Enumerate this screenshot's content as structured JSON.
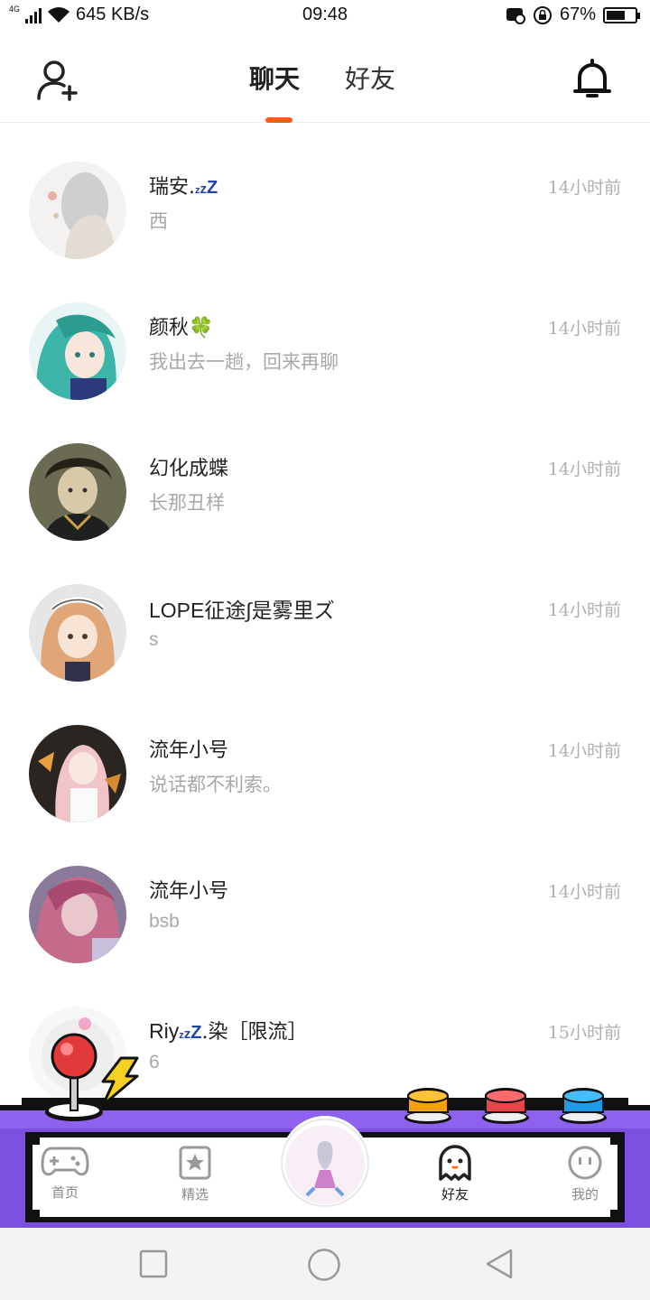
{
  "status_bar": {
    "network_type": "4G",
    "speed": "645 KB/s",
    "time": "09:48",
    "battery_percent": "67%",
    "battery_level": 0.67
  },
  "header": {
    "tabs": [
      {
        "label": "聊天",
        "active": true
      },
      {
        "label": "好友",
        "active": false
      }
    ]
  },
  "chats": [
    {
      "name": "瑞安.",
      "name_suffix": "zzZ",
      "preview": "西",
      "time": "14小时前"
    },
    {
      "name": "颜秋🍀",
      "preview": "我出去一趟，回来再聊",
      "time": "14小时前"
    },
    {
      "name": "幻化成蝶",
      "preview": "长那丑样",
      "time": "14小时前"
    },
    {
      "name": "LOPE征途∫是雾里ズ",
      "preview": "s",
      "time": "14小时前"
    },
    {
      "name": "流年小号",
      "preview": "说话都不利索。",
      "time": "14小时前"
    },
    {
      "name": "流年小号",
      "preview": "bsb",
      "time": "14小时前"
    },
    {
      "name_prefix": "Riy",
      "name_suffix": "zzZ",
      "name": ".染［限流］",
      "preview": "6",
      "time": "15小时前"
    }
  ],
  "bottom_nav": [
    {
      "label": "首页",
      "icon": "gamepad-icon",
      "active": false
    },
    {
      "label": "精选",
      "icon": "star-card-icon",
      "active": false
    },
    {
      "label": "好友",
      "icon": "ghost-icon",
      "active": true
    },
    {
      "label": "我的",
      "icon": "smiley-icon",
      "active": false
    }
  ],
  "colors": {
    "accent": "#ff5a1a",
    "arcade_purple": "#7b4fe0",
    "button_orange": "#f5a20a",
    "button_red": "#e8454a",
    "button_blue": "#1e9be8"
  }
}
